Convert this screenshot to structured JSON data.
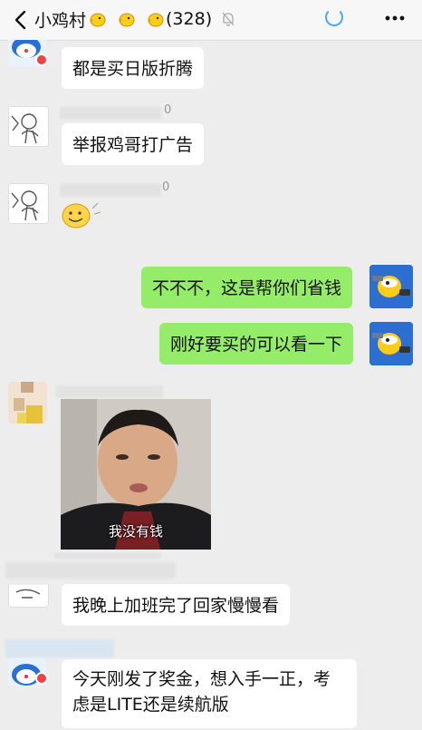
{
  "header": {
    "title": "小鸡村",
    "member_count": "(328)",
    "icons": [
      "back-icon",
      "chick-emoji-icon",
      "bell-muted-icon",
      "loading-icon",
      "more-icon"
    ]
  },
  "messages": [
    {
      "side": "left",
      "text": "都是买日版折腾"
    },
    {
      "side": "left",
      "nick_suffix": "0",
      "text": "举报鸡哥打广告"
    },
    {
      "side": "left",
      "nick_suffix": "0",
      "sticker": "smiley-face-sticker"
    },
    {
      "side": "right",
      "text": "不不不，这是帮你们省钱"
    },
    {
      "side": "right",
      "text": "刚好要买的可以看一下"
    },
    {
      "side": "left",
      "image_caption": "我没有钱"
    },
    {
      "side": "left",
      "text": "我晚上加班完了回家慢慢看"
    },
    {
      "side": "left",
      "text": "今天刚发了奖金，想入手一正，考虑是LITE还是续航版"
    }
  ],
  "colors": {
    "bubble_green": "#95ec69",
    "bubble_white": "#ffffff",
    "background": "#ededed"
  }
}
